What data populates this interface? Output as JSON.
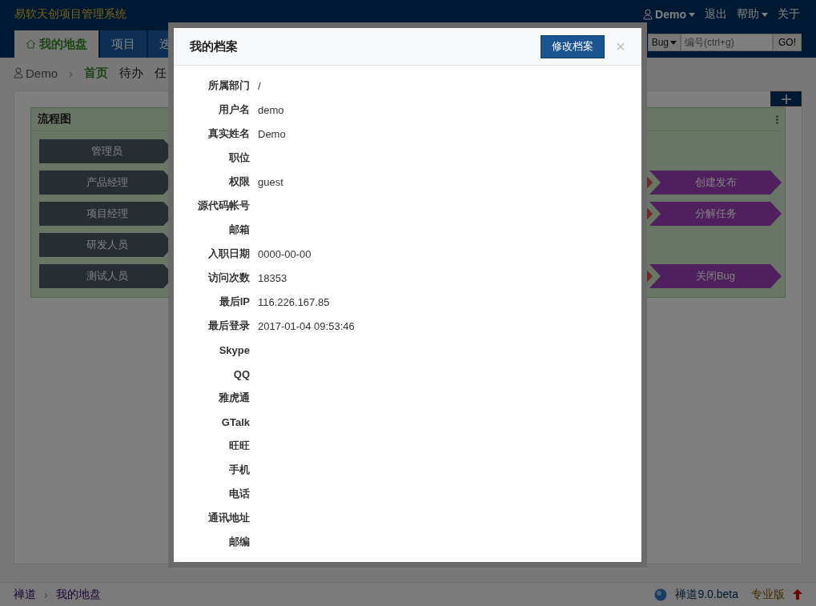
{
  "app_title": "易软天创项目管理系统",
  "user_menu": {
    "user": "Demo",
    "logout": "退出",
    "help": "帮助",
    "about": "关于"
  },
  "nav_tabs": [
    {
      "label": "我的地盘",
      "selected": true
    },
    {
      "label": "项目",
      "selected": false
    },
    {
      "label": "迭",
      "selected": false
    }
  ],
  "search": {
    "type": "Bug",
    "placeholder": "编号(ctrl+g)",
    "button": "GO!"
  },
  "breadcrumb": {
    "user": "Demo",
    "items": [
      {
        "label": "首页",
        "selected": true
      },
      {
        "label": "待办",
        "selected": false
      },
      {
        "label": "任",
        "selected": false
      }
    ],
    "separator": "›"
  },
  "flow_panel": {
    "title": "流程图",
    "rows": [
      {
        "role": "管理员"
      },
      {
        "role": "产品经理",
        "end": "创建发布"
      },
      {
        "role": "项目经理",
        "end": "分解任务"
      },
      {
        "role": "研发人员"
      },
      {
        "role": "测试人员",
        "end": "关闭Bug"
      }
    ]
  },
  "dialog": {
    "title": "我的档案",
    "edit_button": "修改档案",
    "close": "×",
    "fields": [
      {
        "label": "所属部门",
        "value": "/"
      },
      {
        "label": "用户名",
        "value": "demo"
      },
      {
        "label": "真实姓名",
        "value": "Demo"
      },
      {
        "label": "职位"
      },
      {
        "label": "权限",
        "value": "guest"
      },
      {
        "label": "源代码帐号"
      },
      {
        "label": "邮箱"
      },
      {
        "label": "入职日期",
        "value": "0000-00-00"
      },
      {
        "label": "访问次数",
        "value": "18353"
      },
      {
        "label": "最后IP",
        "value": "116.226.167.85"
      },
      {
        "label": "最后登录",
        "value": "2017-01-04 09:53:46"
      },
      {
        "label": "Skype"
      },
      {
        "label": "QQ"
      },
      {
        "label": "雅虎通"
      },
      {
        "label": "GTalk"
      },
      {
        "label": "旺旺"
      },
      {
        "label": "手机"
      },
      {
        "label": "电话"
      },
      {
        "label": "通讯地址"
      },
      {
        "label": "邮编"
      }
    ]
  },
  "footer": {
    "crumbs": [
      "禅道",
      "我的地盘"
    ],
    "separator": "›",
    "version": "禅道9.0.beta",
    "edition": "专业版"
  }
}
